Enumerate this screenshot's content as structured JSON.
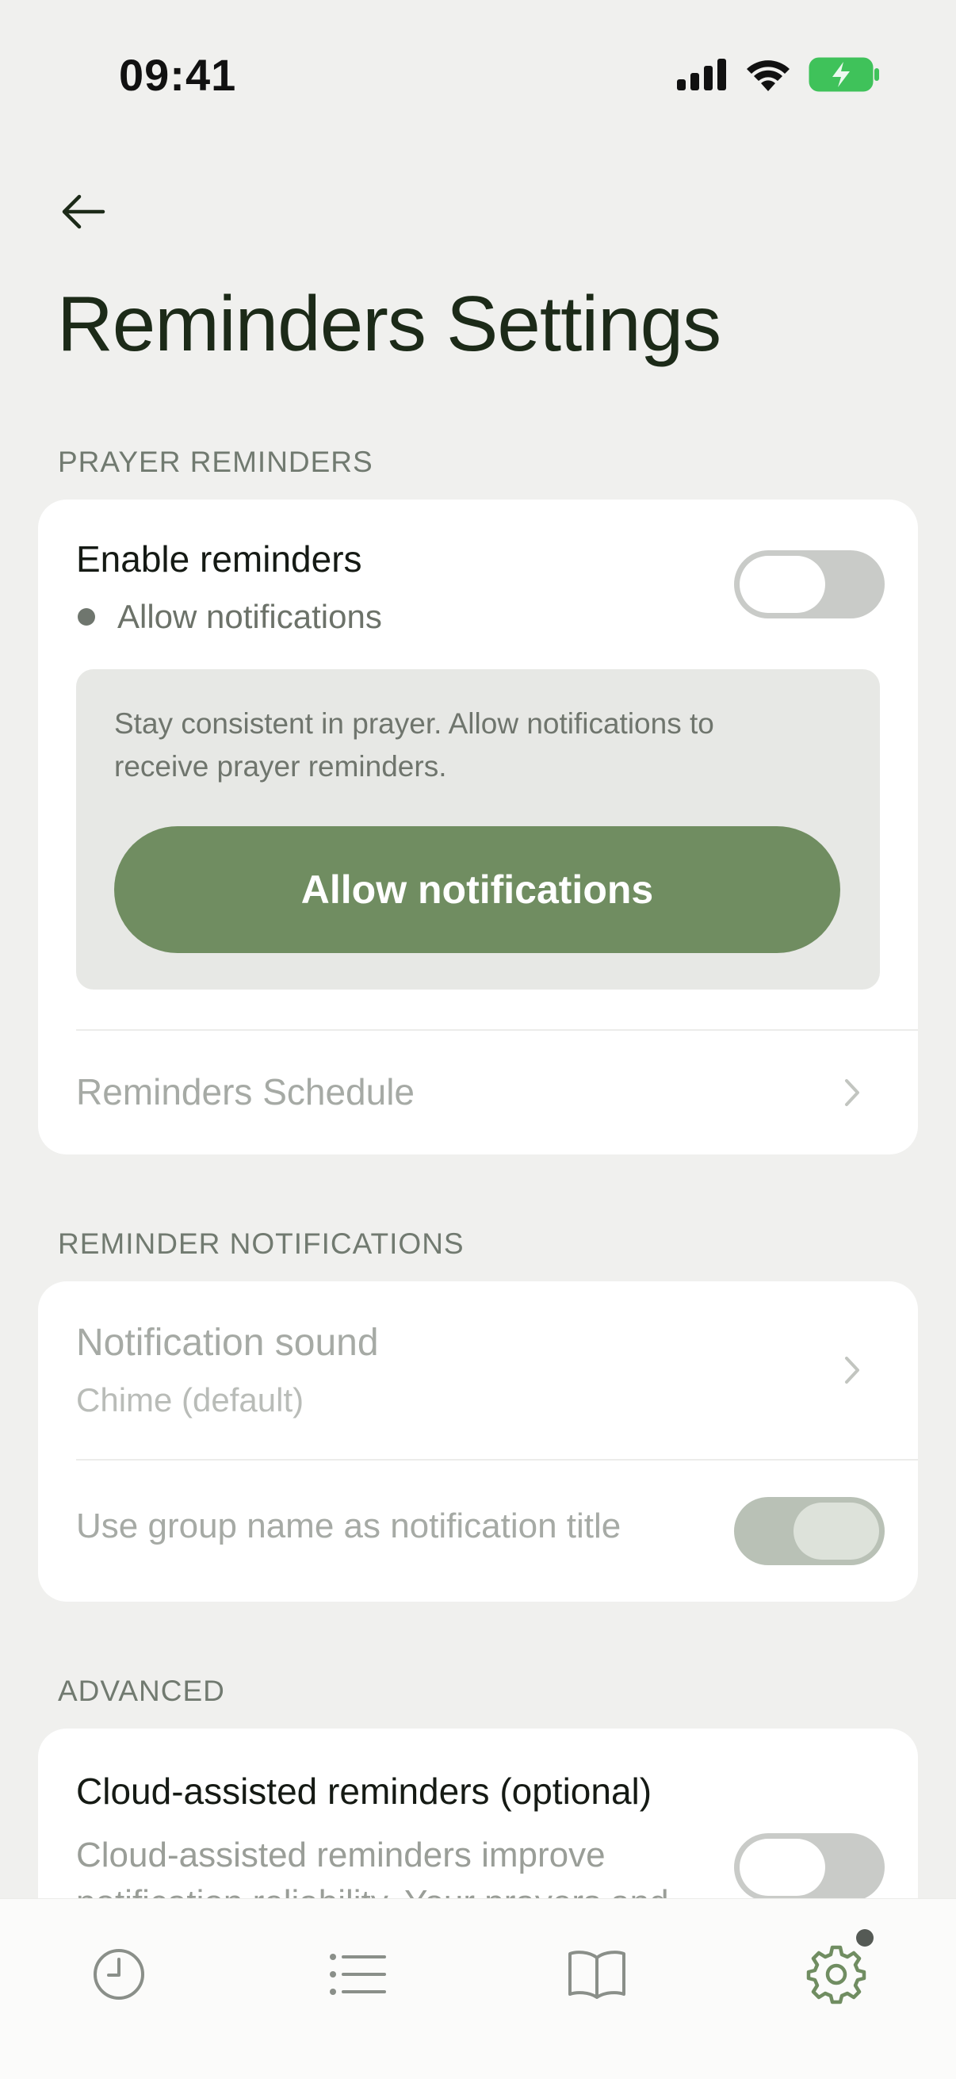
{
  "status_bar": {
    "time": "09:41",
    "icons": [
      "signal-icon",
      "wifi-icon",
      "battery-charging-icon"
    ]
  },
  "header": {
    "back_icon": "arrow-left-icon",
    "title": "Reminders Settings"
  },
  "prayer_reminders": {
    "section_label": "PRAYER REMINDERS",
    "enable_title": "Enable reminders",
    "enable_status": "Allow notifications",
    "enable_toggle_on": false,
    "info_text": "Stay consistent in prayer. Allow notifications to receive prayer reminders.",
    "allow_button": "Allow notifications",
    "schedule_label": "Reminders Schedule"
  },
  "reminder_notifications": {
    "section_label": "REMINDER NOTIFICATIONS",
    "sound_title": "Notification sound",
    "sound_value": "Chime (default)",
    "group_title_label": "Use group name as notification title",
    "group_title_toggle_on": true
  },
  "advanced": {
    "section_label": "ADVANCED",
    "cloud_title": "Cloud-assisted reminders (optional)",
    "cloud_desc": "Cloud-assisted reminders improve notification reliability. Your prayers and",
    "cloud_toggle_on": false
  },
  "tab_bar": {
    "tabs": [
      "history-icon",
      "list-icon",
      "book-icon",
      "settings-icon"
    ],
    "active_tab": "settings-icon"
  },
  "colors": {
    "accent": "#708d61",
    "background": "#f0f0ee",
    "card": "#ffffff",
    "title": "#1c2a18"
  }
}
